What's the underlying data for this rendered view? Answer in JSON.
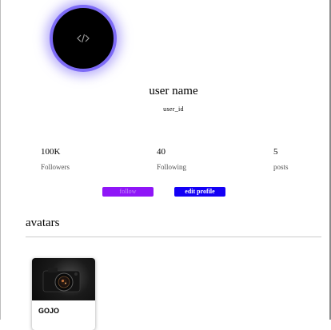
{
  "profile": {
    "avatar_icon": "code-icon",
    "avatar_ring_color": "#7d6bf6",
    "username": "user name",
    "user_id": "user_id"
  },
  "stats": [
    {
      "value": "100K",
      "label": "Followers"
    },
    {
      "value": "40",
      "label": "Following"
    },
    {
      "value": "5",
      "label": "posts"
    }
  ],
  "actions": {
    "follow_label": "follow",
    "follow_color": "#8f16f7",
    "edit_label": "edit profile",
    "edit_color": "#1400f5"
  },
  "avatars_section": {
    "title": "avatars",
    "items": [
      {
        "name": "GOJO",
        "image": "camera-photo"
      }
    ]
  }
}
